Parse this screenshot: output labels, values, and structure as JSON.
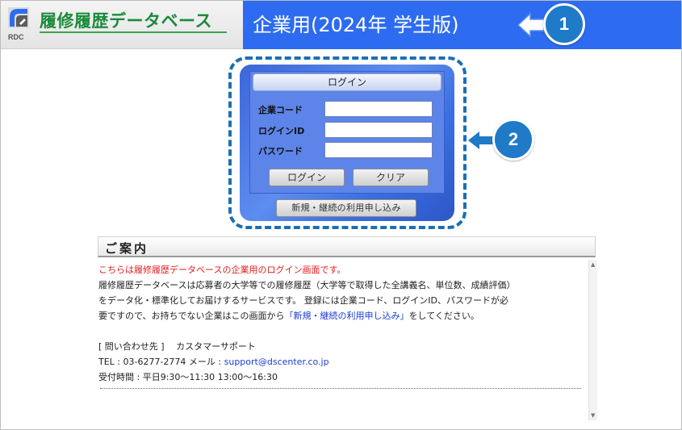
{
  "header": {
    "logo_text": "履修履歴データベース",
    "logo_sub": "RDC",
    "title": "企業用(2024年 学生版)"
  },
  "callouts": {
    "one": "1",
    "two": "2"
  },
  "login": {
    "heading": "ログイン",
    "fields": [
      {
        "label": "企業コード",
        "value": ""
      },
      {
        "label": "ログインID",
        "value": ""
      },
      {
        "label": "パスワード",
        "value": ""
      }
    ],
    "login_button": "ログイン",
    "clear_button": "クリア",
    "apply_button": "新規・継続の利用申し込み"
  },
  "guide": {
    "heading": "ご案内",
    "line1": "こちらは履修履歴データベースの企業用のログイン画面です。",
    "line2": "履修履歴データベースは応募者の大学等での履修履歴（大学等で取得した全講義名、単位数、成績評価）",
    "line3": "をデータ化・標準化してお届けするサービスです。 登録には企業コード、ログインID、パスワードが必",
    "line4a": "要ですので、お持ちでない企業はこの画面から",
    "line4_link": "「新規・継続の利用申し込み」",
    "line4b": "をしてください。",
    "contact_title": "[ 問い合わせ先 ]　 カスタマーサポート",
    "tel": "TEL : 03-6277-2774 メール : ",
    "email": "support@dscenter.co.jp",
    "hours": "受付時間 : 平日9:30～11:30 13:00～16:30"
  },
  "colors": {
    "title_bar": "#2d6cf0",
    "logo_green": "#1b8a3a",
    "callout": "#1f7ac8",
    "login_panel": "#4a78e4",
    "notice_red": "#e21d1d",
    "link_blue": "#1b3bd6"
  }
}
